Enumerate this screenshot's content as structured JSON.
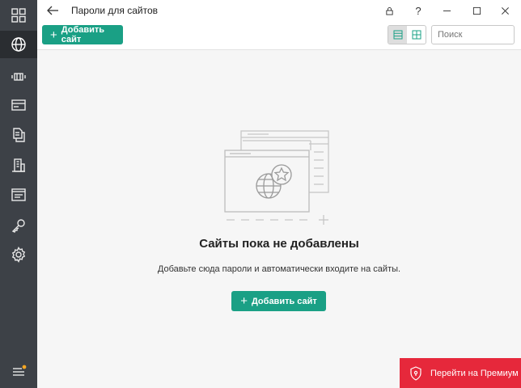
{
  "window": {
    "title": "Пароли для сайтов",
    "help_label": "?"
  },
  "sidebar": {
    "items": [
      {
        "icon": "dashboard-icon",
        "active": false
      },
      {
        "icon": "globe-icon",
        "active": true
      },
      {
        "icon": "card-reader-icon",
        "active": false
      },
      {
        "icon": "bank-card-icon",
        "active": false
      },
      {
        "icon": "documents-icon",
        "active": false
      },
      {
        "icon": "building-icon",
        "active": false
      },
      {
        "icon": "note-icon",
        "active": false
      },
      {
        "icon": "key-icon",
        "active": false
      },
      {
        "icon": "settings-icon",
        "active": false
      }
    ],
    "menu_icon": "menu-icon",
    "notification_color": "#f5a623"
  },
  "toolbar": {
    "add_label": "Добавить сайт",
    "search_placeholder": "Поиск",
    "view_mode": "list"
  },
  "empty_state": {
    "title": "Сайты пока не добавлены",
    "description": "Добавьте сюда пароли и автоматически входите на сайты.",
    "add_label": "Добавить сайт"
  },
  "premium": {
    "label": "Перейти на Премиум"
  },
  "colors": {
    "accent": "#1aa085",
    "premium": "#e6283b",
    "sidebar": "#3d4147"
  }
}
